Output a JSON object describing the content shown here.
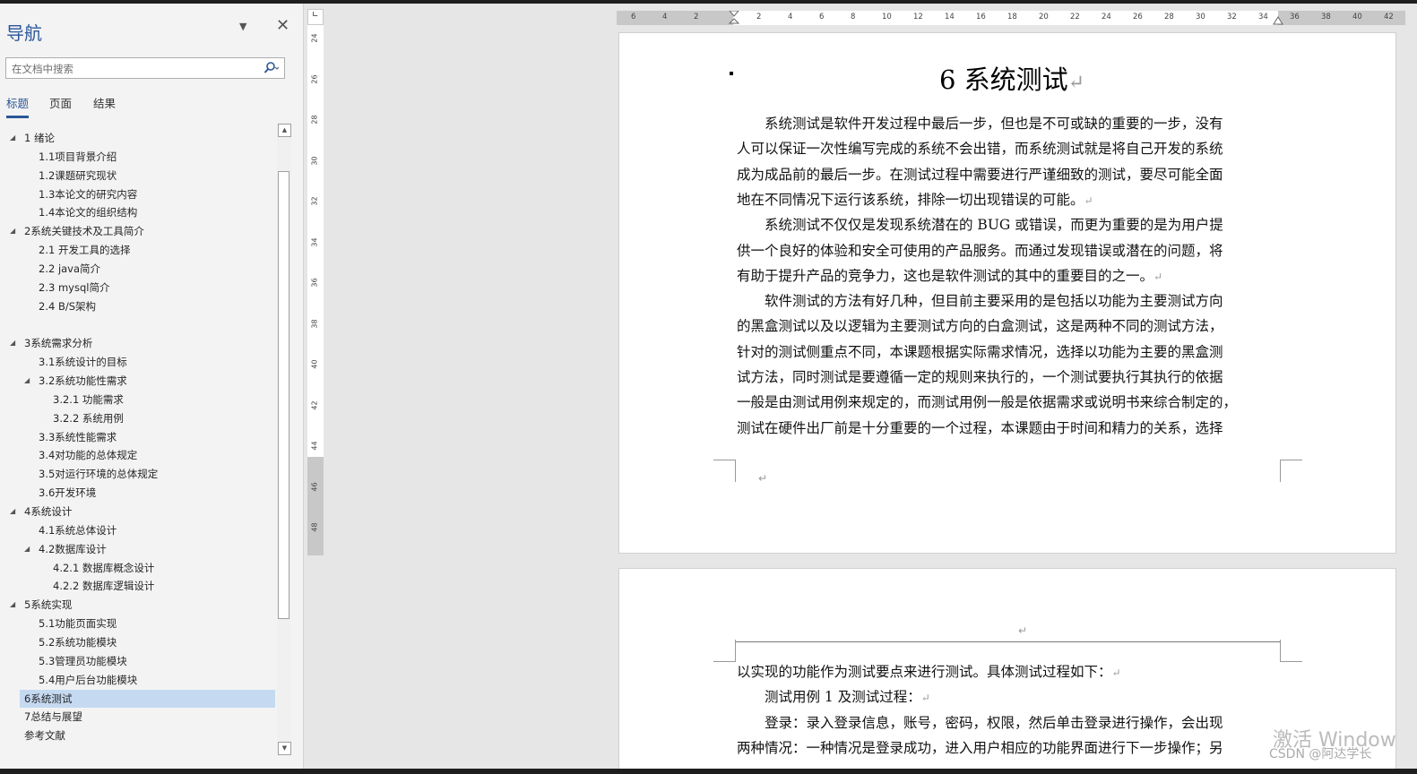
{
  "nav": {
    "title": "导航",
    "search_placeholder": "在文档中搜索",
    "tabs": [
      "标题",
      "页面",
      "结果"
    ],
    "items": [
      {
        "label": "1 绪论",
        "level": 1,
        "caret": true
      },
      {
        "label": "1.1项目背景介绍",
        "level": 2
      },
      {
        "label": "1.2课题研究现状",
        "level": 2
      },
      {
        "label": "1.3本论文的研究内容",
        "level": 2
      },
      {
        "label": "1.4本论文的组织结构",
        "level": 2
      },
      {
        "label": "2系统关键技术及工具简介",
        "level": 1,
        "caret": true
      },
      {
        "label": "2.1 开发工具的选择",
        "level": 2
      },
      {
        "label": "2.2 java简介",
        "level": 2
      },
      {
        "label": "2.3 mysql简介",
        "level": 2
      },
      {
        "label": "2.4 B/S架构",
        "level": 2
      },
      {
        "label": "3系统需求分析",
        "level": 1,
        "caret": true
      },
      {
        "label": "3.1系统设计的目标",
        "level": 2
      },
      {
        "label": "3.2系统功能性需求",
        "level": 2,
        "caret": true
      },
      {
        "label": "3.2.1 功能需求",
        "level": 3
      },
      {
        "label": "3.2.2 系统用例",
        "level": 3
      },
      {
        "label": "3.3系统性能需求",
        "level": 2
      },
      {
        "label": "3.4对功能的总体规定",
        "level": 2
      },
      {
        "label": "3.5对运行环境的总体规定",
        "level": 2
      },
      {
        "label": "3.6开发环境",
        "level": 2
      },
      {
        "label": "4系统设计",
        "level": 1,
        "caret": true
      },
      {
        "label": "4.1系统总体设计",
        "level": 2
      },
      {
        "label": "4.2数据库设计",
        "level": 2,
        "caret": true
      },
      {
        "label": "4.2.1 数据库概念设计",
        "level": 3
      },
      {
        "label": "4.2.2 数据库逻辑设计",
        "level": 3
      },
      {
        "label": "5系统实现",
        "level": 1,
        "caret": true
      },
      {
        "label": "5.1功能页面实现",
        "level": 2
      },
      {
        "label": "5.2系统功能模块",
        "level": 2
      },
      {
        "label": "5.3管理员功能模块",
        "level": 2
      },
      {
        "label": "5.4用户后台功能模块",
        "level": 2
      },
      {
        "label": "6系统测试",
        "level": 1,
        "selected": true
      },
      {
        "label": "7总结与展望",
        "level": 1
      },
      {
        "label": "参考文献",
        "level": 1
      }
    ]
  },
  "ruler": {
    "h_ticks": [
      "6",
      "4",
      "2",
      "",
      "2",
      "4",
      "6",
      "8",
      "10",
      "12",
      "14",
      "16",
      "18",
      "20",
      "22",
      "24",
      "26",
      "28",
      "30",
      "32",
      "34",
      "36",
      "38",
      "40",
      "42"
    ],
    "v_ticks": [
      "24",
      "26",
      "28",
      "30",
      "32",
      "34",
      "36",
      "38",
      "40",
      "42",
      "44",
      "46",
      "48"
    ]
  },
  "doc": {
    "heading": "6 系统测试",
    "page1_lines": [
      "　　系统测试是软件开发过程中最后一步，但也是不可或缺的重要的一步，没有",
      "人可以保证一次性编写完成的系统不会出错，而系统测试就是将自己开发的系统",
      "成为成品前的最后一步。在测试过程中需要进行严谨细致的测试，要尽可能全面",
      "地在不同情况下运行该系统，排除一切出现错误的可能。",
      "　　系统测试不仅仅是发现系统潜在的 BUG 或错误，而更为重要的是为用户提",
      "供一个良好的体验和安全可使用的产品服务。而通过发现错误或潜在的问题，将",
      "有助于提升产品的竞争力，这也是软件测试的其中的重要目的之一。",
      "　　软件测试的方法有好几种，但目前主要采用的是包括以功能为主要测试方向",
      "的黑盒测试以及以逻辑为主要测试方向的白盒测试，这是两种不同的测试方法，",
      "针对的测试侧重点不同，本课题根据实际需求情况，选择以功能为主要的黑盒测",
      "试方法，同时测试是要遵循一定的规则来执行的，一个测试要执行其执行的依据",
      "一般是由测试用例来规定的，而测试用例一般是依据需求或说明书来综合制定的，",
      "测试在硬件出厂前是十分重要的一个过程，本课题由于时间和精力的关系，选择"
    ],
    "page1_para_end_lines": [
      3,
      6
    ],
    "page2_lines": [
      "以实现的功能作为测试要点来进行测试。具体测试过程如下：",
      "　　测试用例 1 及测试过程：",
      "　　登录：录入登录信息，账号，密码，权限，然后单击登录进行操作，会出现",
      "两种情况：一种情况是登录成功，进入用户相应的功能界面进行下一步操作；另"
    ],
    "page2_para_end_lines": [
      0,
      1
    ],
    "para_mark": "↵"
  },
  "watermark": {
    "activate": "激活 Window",
    "credit": "CSDN @阿达学长"
  }
}
